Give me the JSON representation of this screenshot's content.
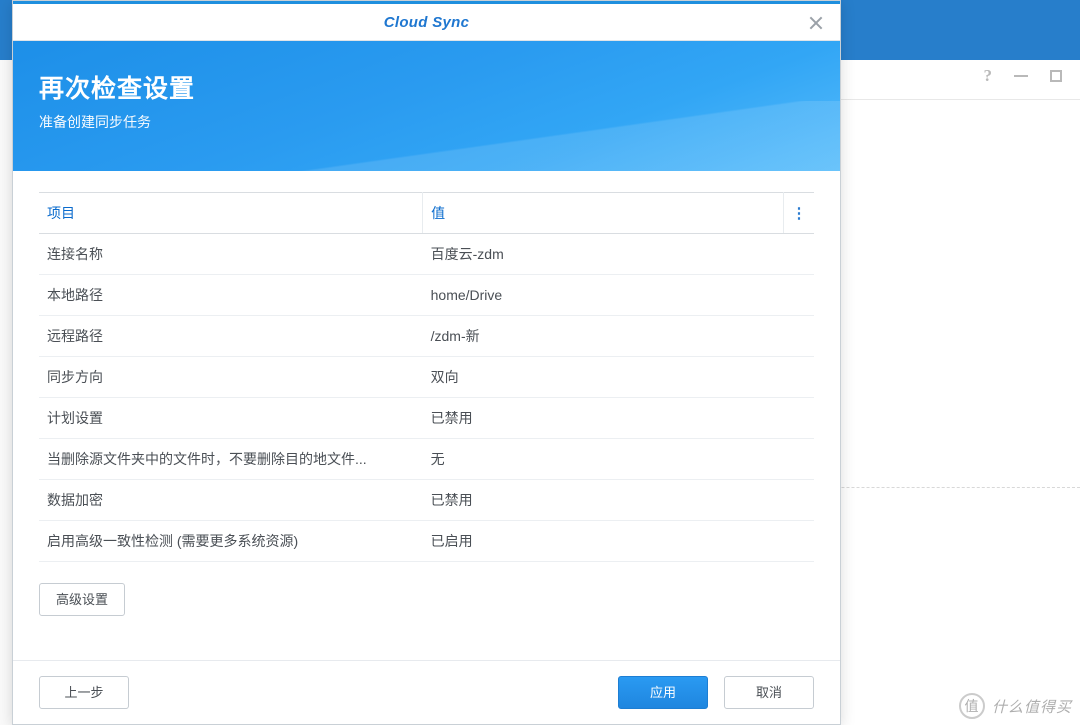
{
  "app_title": "Cloud Sync",
  "banner": {
    "heading": "再次检查设置",
    "subheading": "准备创建同步任务"
  },
  "table": {
    "header_item": "项目",
    "header_value": "值",
    "rows": [
      {
        "item": "连接名称",
        "value": "百度云-zdm"
      },
      {
        "item": "本地路径",
        "value": "home/Drive"
      },
      {
        "item": "远程路径",
        "value": "/zdm-新"
      },
      {
        "item": "同步方向",
        "value": "双向"
      },
      {
        "item": "计划设置",
        "value": "已禁用"
      },
      {
        "item": "当删除源文件夹中的文件时，不要删除目的地文件...",
        "value": "无"
      },
      {
        "item": "数据加密",
        "value": "已禁用"
      },
      {
        "item": "启用高级一致性检测 (需要更多系统资源)",
        "value": "已启用"
      }
    ]
  },
  "buttons": {
    "advanced": "高级设置",
    "back": "上一步",
    "apply": "应用",
    "cancel": "取消"
  },
  "watermark": {
    "icon": "值",
    "text": "什么值得买"
  }
}
